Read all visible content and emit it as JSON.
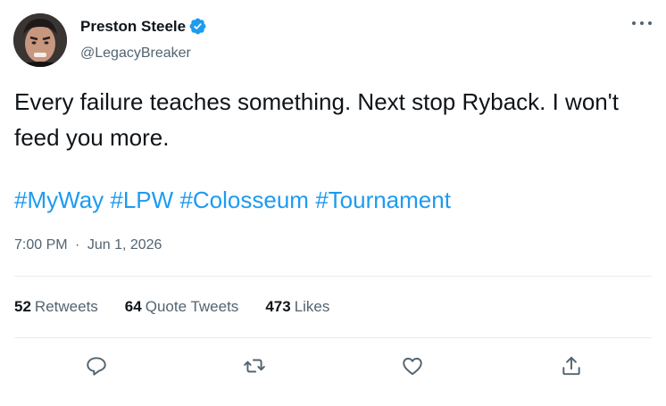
{
  "author": {
    "name": "Preston Steele",
    "handle": "@LegacyBreaker",
    "verified": true,
    "verified_color": "#1d9bf0"
  },
  "tweet": {
    "text": "Every failure teaches something. Next stop Ryback. I won't feed you more.",
    "hashtags": [
      "#MyWay",
      "#LPW",
      "#Colosseum",
      "#Tournament"
    ],
    "time": "7:00 PM",
    "separator": "·",
    "date": "Jun 1, 2026"
  },
  "stats": {
    "retweets": {
      "count": "52",
      "label": "Retweets"
    },
    "quote_tweets": {
      "count": "64",
      "label": "Quote Tweets"
    },
    "likes": {
      "count": "473",
      "label": "Likes"
    }
  },
  "actions": [
    "reply-icon",
    "retweet-icon",
    "like-icon",
    "share-icon"
  ],
  "colors": {
    "text": "#0f1419",
    "muted": "#536471",
    "link": "#1d9bf0",
    "divider": "#e8ecef"
  }
}
